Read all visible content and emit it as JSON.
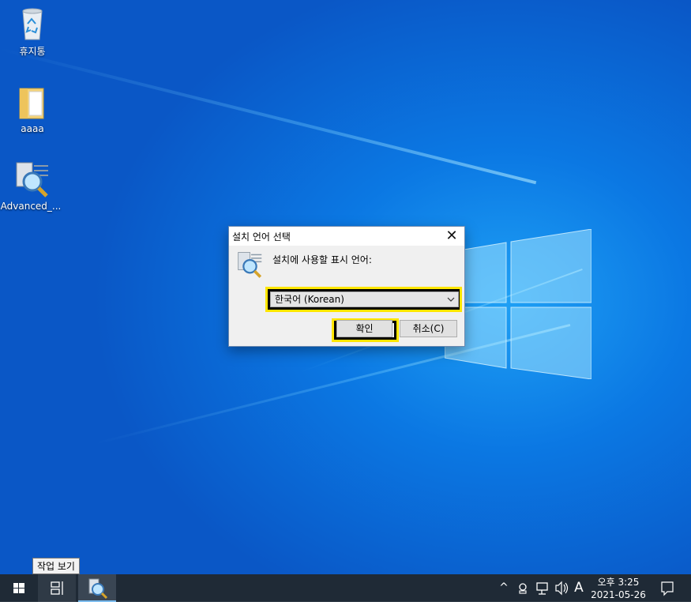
{
  "desktop": {
    "icons": [
      {
        "label": "휴지통",
        "icon": "recycle-bin-icon"
      },
      {
        "label": "aaaa",
        "icon": "folder-icon"
      },
      {
        "label": "Advanced_...",
        "icon": "setup-magnifier-icon"
      }
    ]
  },
  "dialog": {
    "title": "설치 언어 선택",
    "close_glyph": "✕",
    "prompt": "설치에 사용할 표시 언어:",
    "language_selected": "한국어 (Korean)",
    "ok_label": "확인",
    "cancel_label": "취소(C)"
  },
  "taskbar": {
    "tooltip": "작업 보기",
    "tray_chevron": "^",
    "ime_label": "A",
    "clock_time": "오후 3:25",
    "clock_date": "2021-05-26"
  },
  "colors": {
    "highlight": "#ffe600",
    "taskbar": "#1f2a36",
    "desktop": "#0b78e3"
  }
}
